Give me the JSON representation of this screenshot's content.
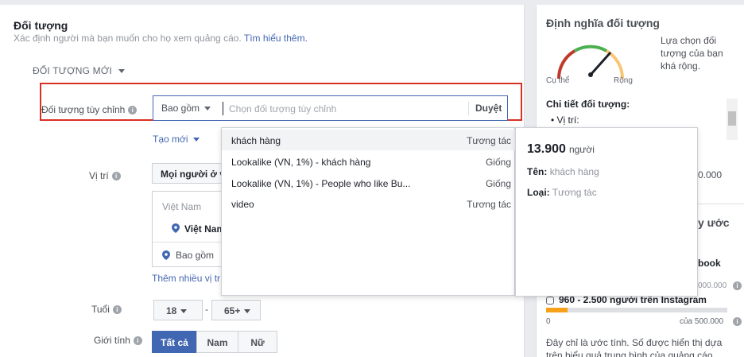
{
  "section": {
    "title": "Đối tượng",
    "subtitle": "Xác định người mà bạn muốn cho họ xem quảng cáo.",
    "learn_more": "Tìm hiểu thêm.",
    "new_audience": "ĐỐI TƯỢNG MỚI"
  },
  "custom_audience": {
    "label": "Đối tượng tùy chỉnh",
    "include": "Bao gồm",
    "placeholder": "Chọn đối tượng tùy chỉnh",
    "browse": "Duyệt",
    "create_new": "Tạo mới"
  },
  "dropdown": {
    "items": [
      {
        "name": "khách hàng",
        "type": "Tương tác"
      },
      {
        "name": "Lookalike (VN, 1%) - khách hàng",
        "type": "Giống"
      },
      {
        "name": "Lookalike (VN, 1%) - People who like Bu...",
        "type": "Giống"
      },
      {
        "name": "video",
        "type": "Tương tác"
      }
    ]
  },
  "tooltip": {
    "count": "13.900",
    "count_unit": "người",
    "name_label": "Tên:",
    "name_value": "khách hàng",
    "type_label": "Loại:",
    "type_value": "Tương tác"
  },
  "location": {
    "label": "Vị trí",
    "select": "Mọi người ở v",
    "country_header": "Việt Nam",
    "country": "Việt Nam",
    "include": "Bao gồm",
    "add_more": "Thêm nhiều vị tr"
  },
  "age": {
    "label": "Tuổi",
    "min": "18",
    "dash": "-",
    "max": "65+"
  },
  "gender": {
    "label": "Giới tính",
    "options": [
      "Tất cả",
      "Nam",
      "Nữ"
    ],
    "selected": "Tất cả"
  },
  "side": {
    "title": "Định nghĩa đối tượng",
    "gauge_left": "Cụ thể",
    "gauge_right": "Rộng",
    "description": "Lựa chọn đối tượng của bạn khá rộng.",
    "details_title": "Chi tiết đối tượng:",
    "details_location": "Vị trí:",
    "tail_count": "0.000",
    "tail_heading": "y ước",
    "tail_facebook": "book",
    "tail_facebook_max": "000.000",
    "instagram_text": "960 - 2.500 người trên Instagram",
    "instagram_fill": 0.12,
    "bar_min": "0",
    "bar_max": "của 500.000",
    "note": "Đây chỉ là ước tính. Số được hiển thị dựa trên biểu quả trung bình của quảng cáo"
  },
  "colors": {
    "accent": "#4267b2",
    "highlight_border": "#d93025",
    "gauge_red": "#c0392b",
    "gauge_green": "#4caf50",
    "gauge_orange": "#f7a01a"
  }
}
